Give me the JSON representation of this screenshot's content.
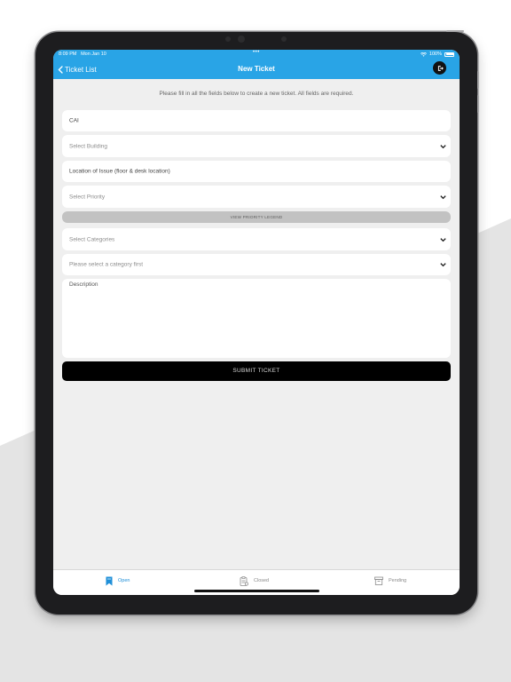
{
  "status_bar": {
    "time": "8:09 PM",
    "date": "Mon Jan 10",
    "dots": "•••",
    "battery": "100%"
  },
  "nav": {
    "back_label": "Ticket List",
    "title": "New Ticket"
  },
  "form": {
    "intro": "Please fill in all the fields below to create a new ticket. All fields are required.",
    "client_value": "CAI",
    "building_placeholder": "Select Building",
    "location_placeholder": "Location of Issue (floor & desk location)",
    "priority_placeholder": "Select Priority",
    "priority_legend_label": "VIEW PRIORITY LEGEND",
    "categories_placeholder": "Select Categories",
    "subcategory_placeholder": "Please select a category first",
    "description_placeholder": "Description",
    "submit_label": "SUBMIT TICKET"
  },
  "tabs": [
    {
      "label": "Open",
      "icon": "bookmark-icon",
      "active": true
    },
    {
      "label": "Closed",
      "icon": "clipboard-icon",
      "active": false
    },
    {
      "label": "Pending",
      "icon": "archive-box-icon",
      "active": false
    }
  ],
  "colors": {
    "accent": "#29a4e6",
    "tab_active": "#1f8fd8",
    "submit_bg": "#000000"
  }
}
